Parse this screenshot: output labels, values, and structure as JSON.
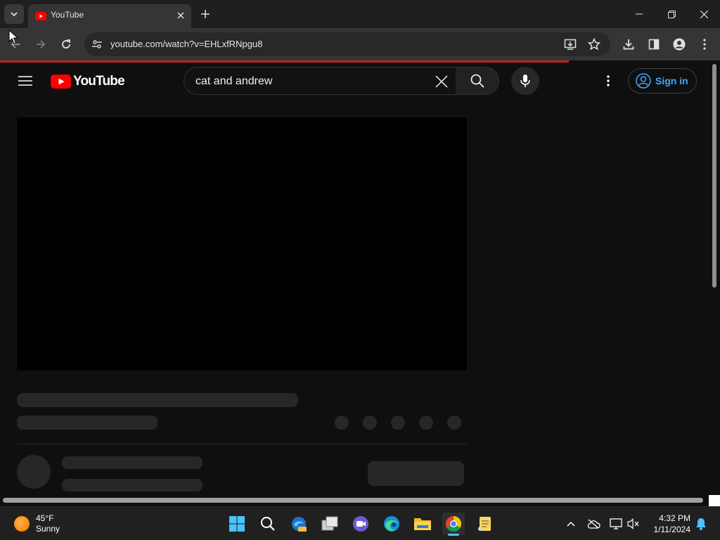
{
  "browser": {
    "tab": {
      "title": "YouTube"
    },
    "address_bar": {
      "url": "youtube.com/watch?v=EHLxfRNpgu8"
    },
    "load_progress": 0.79
  },
  "youtube": {
    "logo_text": "YouTube",
    "search": {
      "query": "cat and andrew"
    },
    "sign_in_label": "Sign in"
  },
  "taskbar": {
    "weather": {
      "temp": "45°F",
      "condition": "Sunny"
    },
    "clock": {
      "time": "4:32 PM",
      "date": "1/11/2024"
    },
    "apps": [
      "start-icon",
      "search-icon",
      "edge-beta-icon",
      "task-view-icon",
      "meet-icon",
      "edge-icon",
      "file-explorer-icon",
      "chrome-icon",
      "notepad-icon"
    ]
  },
  "colors": {
    "accent_red": "#ff0000",
    "link_blue": "#3ea6ff",
    "page_bg": "#0f0f0f"
  }
}
